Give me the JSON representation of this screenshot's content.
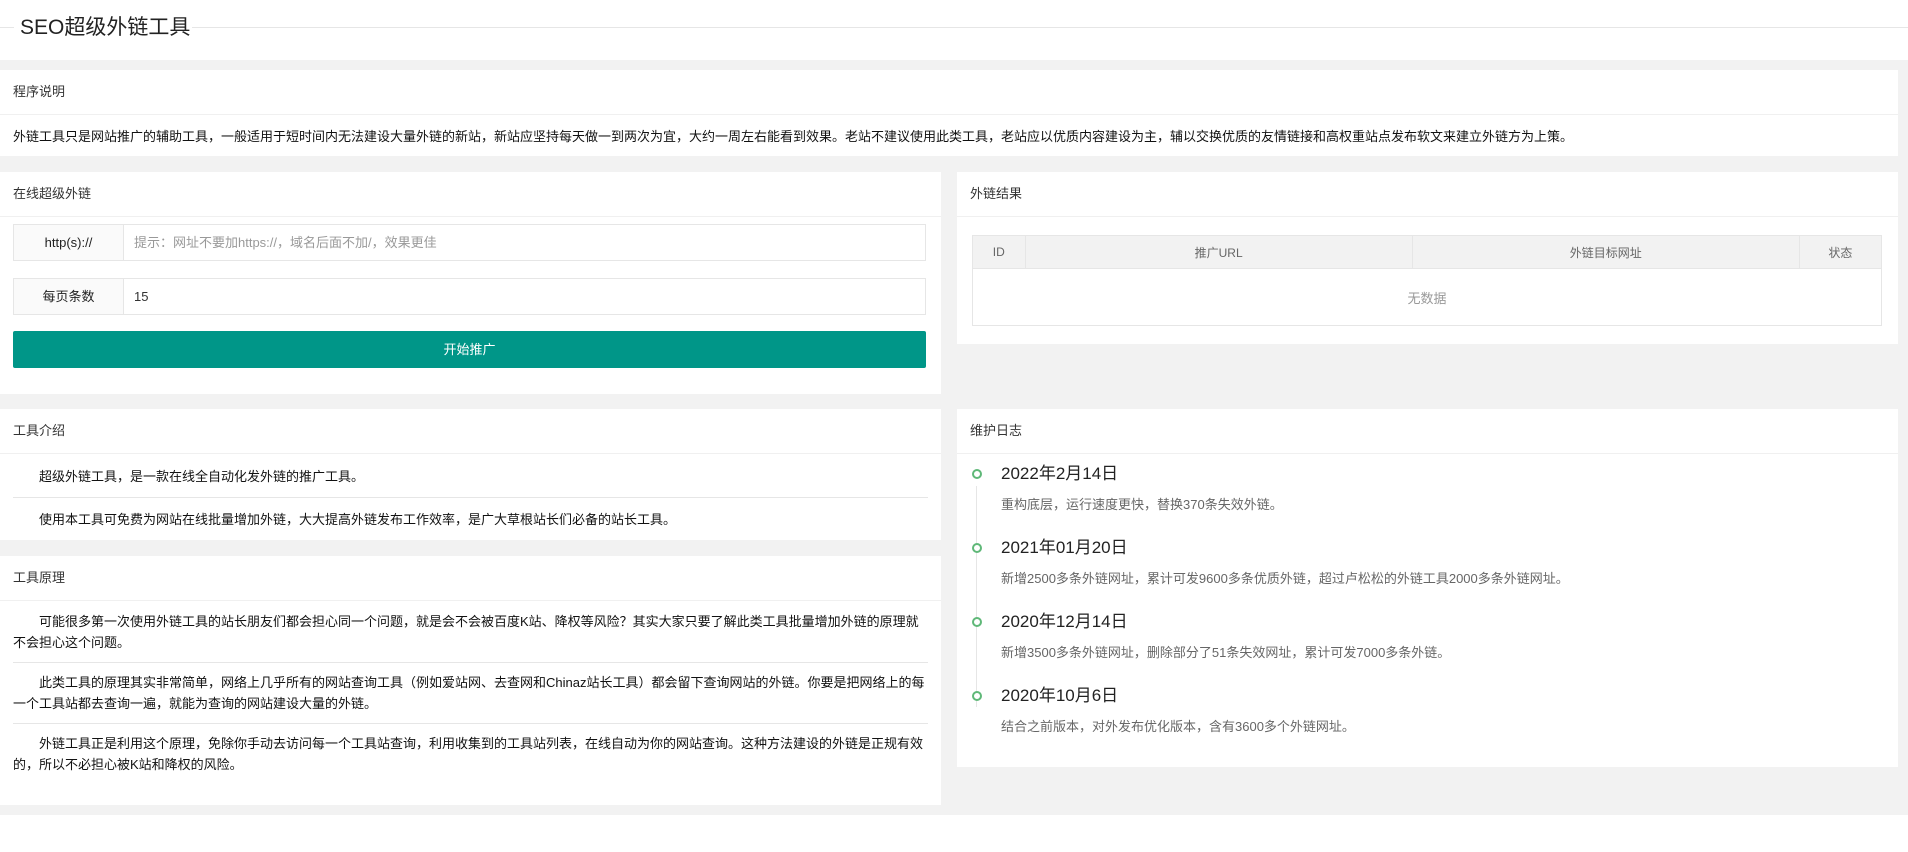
{
  "header": {
    "title": "SEO超级外链工具"
  },
  "notice": {
    "heading": "程序说明",
    "text": "外链工具只是网站推广的辅助工具，一般适用于短时间内无法建设大量外链的新站，新站应坚持每天做一到两次为宜，大约一周左右能看到效果。老站不建议使用此类工具，老站应以优质内容建设为主，辅以交换优质的友情链接和高权重站点发布软文来建立外链方为上策。"
  },
  "form": {
    "heading": "在线超级外链",
    "url_label": "http(s)://",
    "url_placeholder": "提示：网址不要加https://，域名后面不加/，效果更佳",
    "url_value": "",
    "count_label": "每页条数",
    "count_value": "15",
    "submit_label": "开始推广"
  },
  "results": {
    "heading": "外链结果",
    "columns": [
      "ID",
      "推广URL",
      "外链目标网址",
      "状态"
    ],
    "empty_text": "无数据"
  },
  "intro": {
    "heading": "工具介绍",
    "paragraphs": [
      "超级外链工具，是一款在线全自动化发外链的推广工具。",
      "使用本工具可免费为网站在线批量增加外链，大大提高外链发布工作效率，是广大草根站长们必备的站长工具。"
    ]
  },
  "principle": {
    "heading": "工具原理",
    "paragraphs": [
      "可能很多第一次使用外链工具的站长朋友们都会担心同一个问题，就是会不会被百度K站、降权等风险？其实大家只要了解此类工具批量增加外链的原理就不会担心这个问题。",
      "此类工具的原理其实非常简单，网络上几乎所有的网站查询工具（例如爱站网、去查网和Chinaz站长工具）都会留下查询网站的外链。你要是把网络上的每一个工具站都去查询一遍，就能为查询的网站建设大量的外链。",
      "外链工具正是利用这个原理，免除你手动去访问每一个工具站查询，利用收集到的工具站列表，在线自动为你的网站查询。这种方法建设的外链是正规有效的，所以不必担心被K站和降权的风险。"
    ]
  },
  "log": {
    "heading": "维护日志",
    "entries": [
      {
        "date": "2022年2月14日",
        "desc": "重构底层，运行速度更快，替换370条失效外链。"
      },
      {
        "date": "2021年01月20日",
        "desc": "新增2500多条外链网址，累计可发9600多条优质外链，超过卢松松的外链工具2000多条外链网址。"
      },
      {
        "date": "2020年12月14日",
        "desc": "新增3500多条外链网址，删除部分了51条失效网址，累计可发7000多条外链。"
      },
      {
        "date": "2020年10月6日",
        "desc": "结合之前版本，对外发布优化版本，含有3600多个外链网址。"
      }
    ]
  },
  "colors": {
    "primary": "#009688",
    "timeline_dot": "#5fb878"
  }
}
